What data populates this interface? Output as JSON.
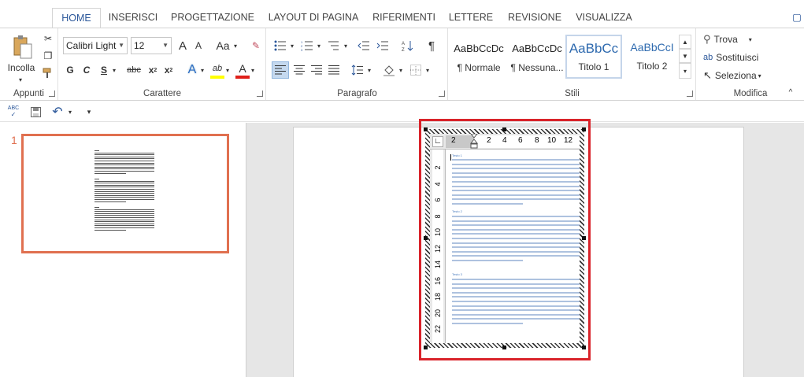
{
  "tabs": [
    "HOME",
    "INSERISCI",
    "PROGETTAZIONE",
    "LAYOUT DI PAGINA",
    "RIFERIMENTI",
    "LETTERE",
    "REVISIONE",
    "VISUALIZZA"
  ],
  "clipboard": {
    "paste_label": "Incolla",
    "group_label": "Appunti"
  },
  "font": {
    "family": "Calibri Light",
    "size": "12",
    "grow_label": "A",
    "shrink_label": "A",
    "case_label": "Aa",
    "bold": "G",
    "italic": "C",
    "underline": "S",
    "strike": "abc",
    "subscript": "x",
    "superscript": "x",
    "effects": "A",
    "highlight": "ab",
    "color": "A",
    "group_label": "Carattere"
  },
  "paragraph": {
    "group_label": "Paragrafo",
    "pilcrow": "¶"
  },
  "styles": {
    "items": [
      {
        "sample": "AaBbCcDc",
        "name": "¶ Normale"
      },
      {
        "sample": "AaBbCcDc",
        "name": "¶ Nessuna..."
      },
      {
        "sample": "AaBbCc",
        "name": "Titolo 1"
      },
      {
        "sample": "AaBbCcI",
        "name": "Titolo 2"
      }
    ],
    "group_label": "Stili"
  },
  "editing": {
    "find": "Trova",
    "replace": "Sostituisci",
    "select": "Seleziona",
    "group_label": "Modifica"
  },
  "thumbnail": {
    "page_number": "1"
  },
  "ruler": {
    "horizontal": [
      "2",
      "2",
      "4",
      "6",
      "8",
      "10",
      "12"
    ],
    "vertical": [
      "2",
      "4",
      "6",
      "8",
      "10",
      "12",
      "14",
      "16",
      "18",
      "20",
      "22"
    ]
  },
  "document": {
    "headings": [
      "Testo 1",
      "Testo 2",
      "Testo 3"
    ]
  },
  "colors": {
    "accent": "#2b579a",
    "selection_red": "#d9232a",
    "thumb_border": "#e07050"
  }
}
